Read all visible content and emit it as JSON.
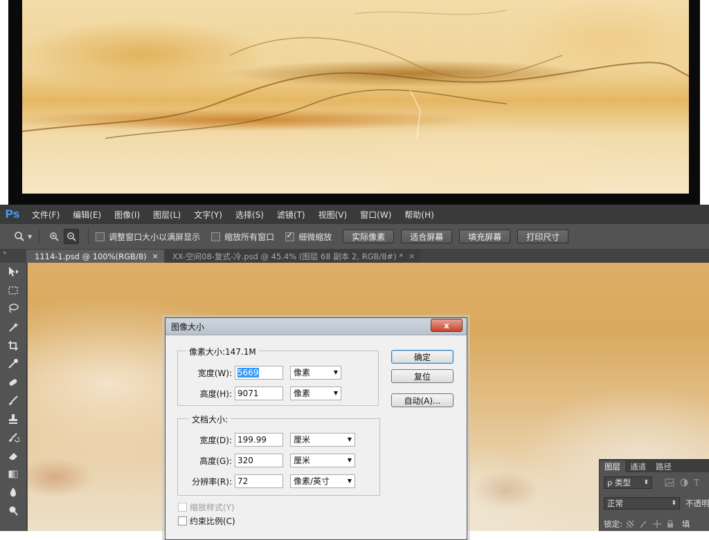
{
  "app": {
    "logo": "Ps",
    "accent_color": "#46a3ff"
  },
  "menu": [
    "文件(F)",
    "编辑(E)",
    "图像(I)",
    "图层(L)",
    "文字(Y)",
    "选择(S)",
    "滤镜(T)",
    "视图(V)",
    "窗口(W)",
    "帮助(H)"
  ],
  "options": {
    "tool_icon": "zoom-tool-icon",
    "checks": [
      {
        "label": "调整窗口大小以满屏显示",
        "checked": false
      },
      {
        "label": "缩放所有窗口",
        "checked": false
      },
      {
        "label": "细微缩放",
        "checked": true
      }
    ],
    "buttons": [
      "实际像素",
      "适合屏幕",
      "填充屏幕",
      "打印尺寸"
    ]
  },
  "tabs": [
    {
      "label": "1114-1.psd @ 100%(RGB/8)",
      "close": "×"
    },
    {
      "label": "XX-空间08-复式-冷.psd @ 45.4% (图层 68 副本 2, RGB/8#) *",
      "close": "×"
    }
  ],
  "toolbox": [
    "move-tool-icon",
    "marquee-tool-icon",
    "lasso-tool-icon",
    "magic-wand-icon",
    "crop-tool-icon",
    "eyedropper-icon",
    "healing-brush-icon",
    "brush-tool-icon",
    "clone-stamp-icon",
    "history-brush-icon",
    "eraser-icon",
    "gradient-tool-icon",
    "blur-tool-icon",
    "dodge-tool-icon"
  ],
  "dialog": {
    "title": "图像大小",
    "close": "x",
    "pixel_dimensions": {
      "legend": "像素大小:147.1M",
      "width_label": "宽度(W):",
      "width_value": "5669",
      "width_unit": "像素",
      "height_label": "高度(H):",
      "height_value": "9071",
      "height_unit": "像素"
    },
    "document_size": {
      "legend": "文档大小:",
      "width_label": "宽度(D):",
      "width_value": "199.99",
      "width_unit": "厘米",
      "height_label": "高度(G):",
      "height_value": "320",
      "height_unit": "厘米",
      "resolution_label": "分辨率(R):",
      "resolution_value": "72",
      "resolution_unit": "像素/英寸"
    },
    "buttons": {
      "ok": "确定",
      "reset": "复位",
      "auto": "自动(A)..."
    },
    "checks": [
      {
        "label": "缩放样式(Y)",
        "checked": false,
        "disabled": true
      },
      {
        "label": "约束比例(C)",
        "checked": false,
        "disabled": false
      }
    ]
  },
  "layers_panel": {
    "tabs": [
      "图层",
      "通道",
      "路径"
    ],
    "filter_label": "ρ 类型",
    "blend_mode": "正常",
    "opacity_label": "不透明",
    "lock_label": "锁定:",
    "fill_label": "填"
  }
}
